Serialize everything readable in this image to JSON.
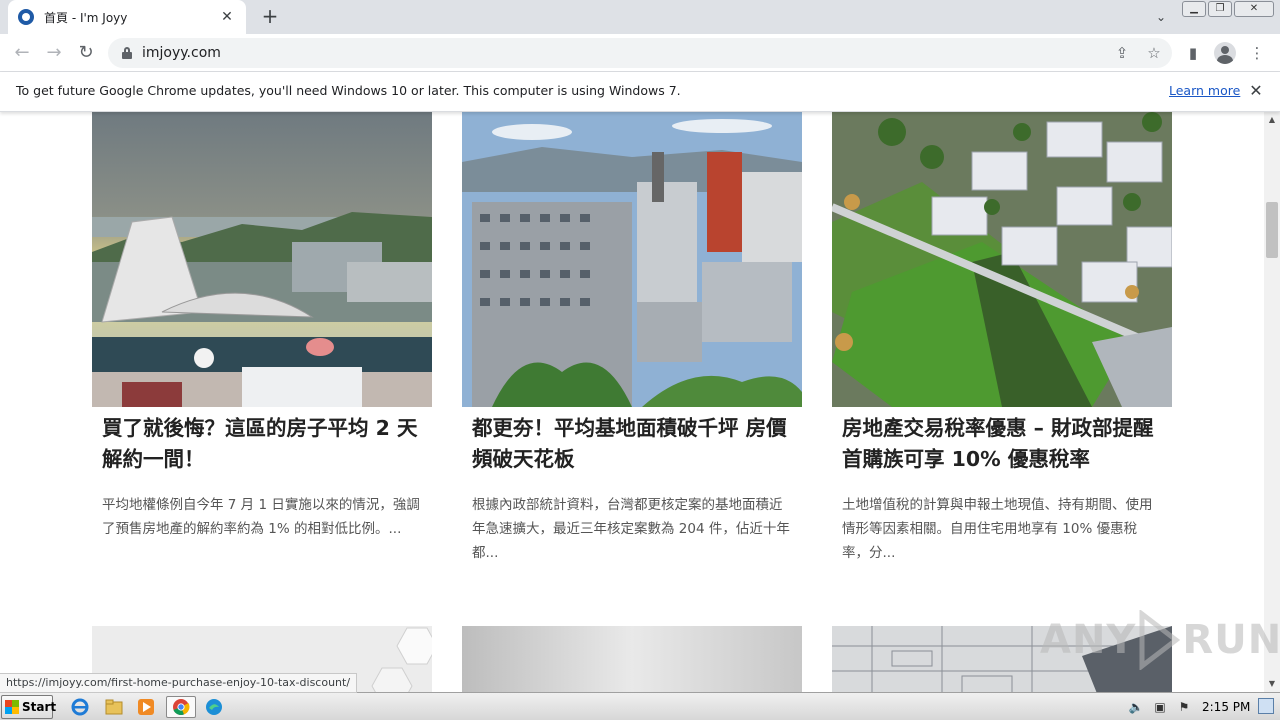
{
  "tab": {
    "title": "首頁 - I'm Joyy",
    "close": "✕"
  },
  "new_tab": "+",
  "tab_search": "⌄",
  "window_controls": {
    "minimize": "▁",
    "restore": "❐",
    "close": "✕"
  },
  "nav": {
    "back": "←",
    "forward": "→",
    "reload": "↻"
  },
  "address": {
    "url": "imjoyy.com"
  },
  "omnibox_icons": {
    "share": "⇪",
    "bookmark": "☆"
  },
  "toolbar_icons": {
    "side_panel": "▮",
    "menu": "⋮"
  },
  "infobar": {
    "message": "To get future Google Chrome updates, you'll need Windows 10 or later. This computer is using Windows 7.",
    "link": "Learn more",
    "close": "✕"
  },
  "cards": [
    {
      "title": "買了就後悔？這區的房子平均 2 天解約一間！",
      "excerpt": "平均地權條例自今年 7 月 1 日實施以來的情況，強調了預售房地產的解約率約為 1% 的相對低比例。..."
    },
    {
      "title": "都更夯！平均基地面積破千坪 房價頻破天花板",
      "excerpt": "根據內政部統計資料，台灣都更核定案的基地面積近年急速擴大，最近三年核定案數為 204 件，佔近十年都..."
    },
    {
      "title": "房地產交易稅率優惠 – 財政部提醒首購族可享 10% 優惠稅率",
      "excerpt": "土地增值稅的計算與申報土地現值、持有期間、使用情形等因素相關。自用住宅用地享有 10% 優惠稅率，分..."
    }
  ],
  "scrollbar": {
    "up": "▲",
    "down": "▼"
  },
  "status_url": "https://imjoyy.com/first-home-purchase-enjoy-10-tax-discount/",
  "watermark": {
    "left": "ANY",
    "right": "RUN"
  },
  "taskbar": {
    "start": "Start",
    "clock": "2:15 PM",
    "tray": {
      "speaker": "🔈",
      "network": "▣",
      "flag": "⚑"
    }
  },
  "colors": {
    "accent_link": "#1a57c6",
    "tab_strip": "#dee1e6"
  }
}
